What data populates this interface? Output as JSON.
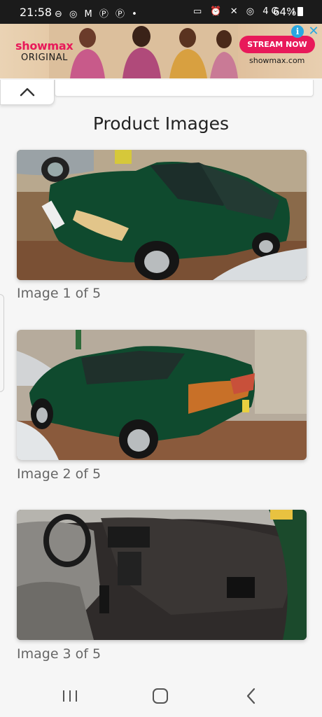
{
  "status_bar": {
    "time": "21:58",
    "left_icons": "⊖ ◎ M Ⓟ Ⓟ •",
    "right_icons": "▭ ⏰ ✕ ◎ 4G .ıl",
    "battery": "64%"
  },
  "ad": {
    "brand": "showmax",
    "brand_sub": "ORIGINAL",
    "cta": "STREAM NOW",
    "url": "showmax.com",
    "adchoice": "i",
    "close": "✕"
  },
  "section": {
    "title": "Product Images"
  },
  "images": [
    {
      "caption": "Image 1 of 5"
    },
    {
      "caption": "Image 2 of 5"
    },
    {
      "caption": "Image 3 of 5"
    }
  ],
  "colors": {
    "brand_pink": "#e8195a",
    "car_green": "#0f4a2e",
    "caption_gray": "#666666",
    "adchoice_blue": "#2aa7e0"
  }
}
